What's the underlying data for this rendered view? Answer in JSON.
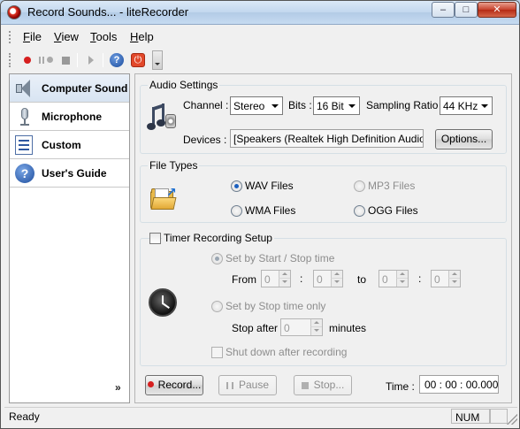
{
  "window": {
    "title": "Record Sounds... - liteRecorder",
    "controls": {
      "minimize": "–",
      "maximize": "□",
      "close": "✕"
    }
  },
  "menu": {
    "items": [
      {
        "label": "File",
        "accel": "F",
        "rest": "ile"
      },
      {
        "label": "View",
        "accel": "V",
        "rest": "iew"
      },
      {
        "label": "Tools",
        "accel": "T",
        "rest": "ools"
      },
      {
        "label": "Help",
        "accel": "H",
        "rest": "elp"
      }
    ]
  },
  "toolbar": {
    "icons": [
      "record-icon",
      "pause-icon",
      "stop-icon",
      "play-icon",
      "help-icon",
      "power-icon",
      "overflow-dropdown-icon"
    ],
    "help_glyph": "?",
    "power_glyph": "⏻"
  },
  "sidebar": {
    "items": [
      {
        "label": "Computer Sound",
        "icon": "speaker-icon",
        "active": true
      },
      {
        "label": "Microphone",
        "icon": "microphone-icon",
        "active": false
      },
      {
        "label": "Custom",
        "icon": "checklist-icon",
        "active": false
      },
      {
        "label": "User's Guide",
        "icon": "help-icon",
        "active": false
      }
    ],
    "guide_glyph": "?",
    "more_glyph": "»"
  },
  "audio_settings": {
    "title": "Audio Settings",
    "channel_label": "Channel :",
    "channel_value": "Stereo",
    "bits_label": "Bits :",
    "bits_value": "16 Bit",
    "sampling_label": "Sampling Ratio :",
    "sampling_value": "44 KHz",
    "devices_label": "Devices :",
    "devices_value": "[Speakers (Realtek High Definition Audio)]",
    "options_button": "Options..."
  },
  "file_types": {
    "title": "File Types",
    "wav": "WAV Files",
    "mp3": "MP3 Files",
    "wma": "WMA Files",
    "ogg": "OGG Files",
    "selected": "WAV Files"
  },
  "timer": {
    "title": "Timer Recording Setup",
    "enabled": false,
    "by_start_stop": "Set by Start / Stop time",
    "from_label": "From",
    "to_label": "to",
    "colon": ":",
    "from_h": "0",
    "from_m": "0",
    "to_h": "0",
    "to_m": "0",
    "by_stop_only": "Set by Stop time only",
    "stop_after_label": "Stop after",
    "stop_after_value": "0",
    "minutes_label": "minutes",
    "shutdown_label": "Shut down after recording"
  },
  "controls": {
    "record": "Record...",
    "pause": "Pause",
    "stop": "Stop...",
    "time_label": "Time :",
    "time_value": "00 : 00 : 00.000"
  },
  "status": {
    "text": "Ready",
    "num": "NUM"
  },
  "colors": {
    "titlebar": "#c2d7ee",
    "record_red": "#d61f1f",
    "selection_blue": "#1b5fbf",
    "close_red": "#c7412c"
  }
}
